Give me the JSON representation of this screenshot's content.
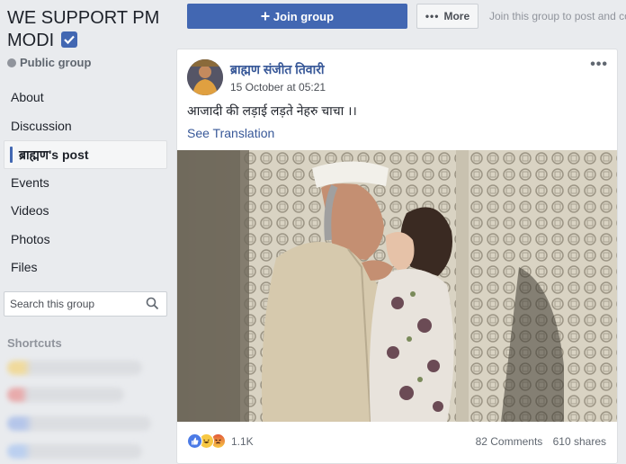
{
  "group": {
    "name": "WE SUPPORT PM MODI",
    "privacy": "Public group"
  },
  "nav": {
    "items": [
      {
        "label": "About"
      },
      {
        "label": "Discussion"
      },
      {
        "label": "ब्राह्मण's post",
        "active": true
      },
      {
        "label": "Events"
      },
      {
        "label": "Videos"
      },
      {
        "label": "Photos"
      },
      {
        "label": "Files"
      }
    ]
  },
  "search": {
    "placeholder": "Search this group"
  },
  "shortcuts": {
    "title": "Shortcuts"
  },
  "topbar": {
    "join_label": "Join group",
    "more_label": "More",
    "hint": "Join this group to post and co"
  },
  "post": {
    "author": "ब्राह्मण संजीत तिवारी",
    "time": "15 October at 05:21",
    "text": "आजादी की लड़ाई लड़ते नेहरु चाचा ।।",
    "translate_label": "See Translation",
    "reaction_count": "1.1K",
    "comments": "82 Comments",
    "shares": "610 shares"
  },
  "colors": {
    "brand_blue": "#4267b2",
    "link_blue": "#385898",
    "background": "#e9ebee"
  }
}
